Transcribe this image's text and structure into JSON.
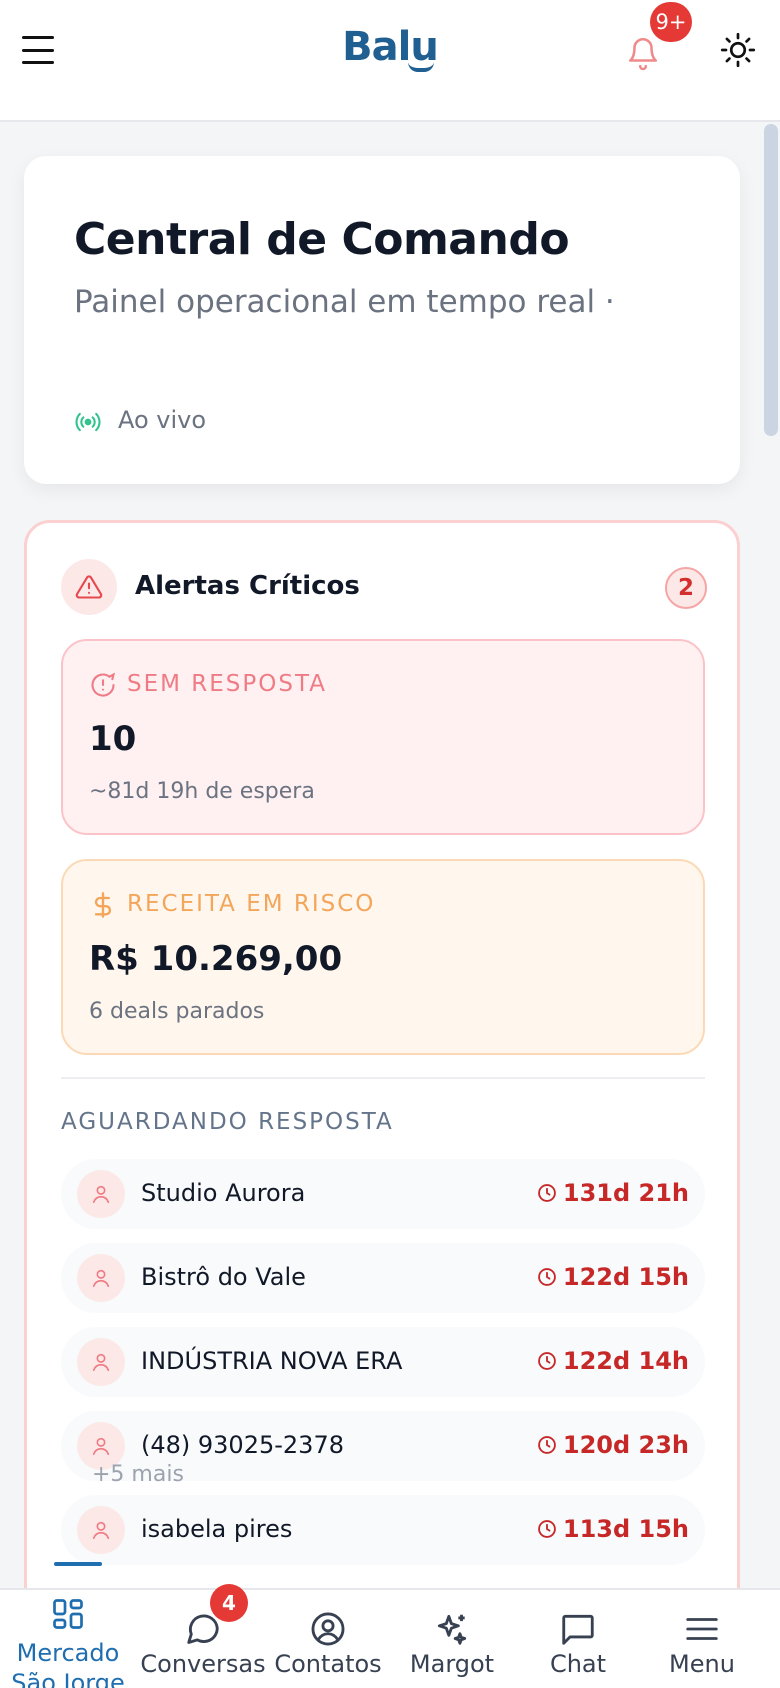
{
  "header": {
    "logo_text": "Balu",
    "notification_badge": "9+"
  },
  "hero": {
    "title": "Central de Comando",
    "subtitle": "Painel operacional em tempo real ·",
    "live_label": "Ao vivo"
  },
  "alerts": {
    "title": "Alertas Críticos",
    "count": "2",
    "cards": [
      {
        "label": "SEM RESPOSTA",
        "value": "10",
        "sub": "~81d 19h de espera",
        "icon": "alert-circle-icon"
      },
      {
        "label": "RECEITA EM RISCO",
        "value": "R$ 10.269,00",
        "sub": "6 deals parados",
        "icon": "dollar-icon"
      }
    ],
    "waiting_label": "AGUARDANDO RESPOSTA",
    "waiting": [
      {
        "name": "Studio Aurora",
        "time": "131d 21h"
      },
      {
        "name": "Bistrô do Vale",
        "time": "122d 15h"
      },
      {
        "name": "INDÚSTRIA NOVA ERA",
        "time": "122d 14h"
      },
      {
        "name": "(48) 93025-2378",
        "time": "120d 23h"
      },
      {
        "name": "isabela pires",
        "time": "113d 15h"
      }
    ],
    "more_text": "+5 mais"
  },
  "nav": {
    "items": [
      {
        "label": "Mercado São Jorge",
        "icon": "grid-icon"
      },
      {
        "label": "Conversas",
        "icon": "chat-bubble-icon"
      },
      {
        "label": "Contatos",
        "icon": "user-circle-icon"
      },
      {
        "label": "Margot",
        "icon": "sparkle-icon"
      },
      {
        "label": "Chat",
        "icon": "message-square-icon"
      },
      {
        "label": "Menu",
        "icon": "menu-icon"
      }
    ],
    "conversas_badge": "4"
  },
  "colors": {
    "brand": "#1f5f91",
    "active": "#1f6fb0",
    "danger": "#c62828",
    "badge": "#e53935"
  }
}
